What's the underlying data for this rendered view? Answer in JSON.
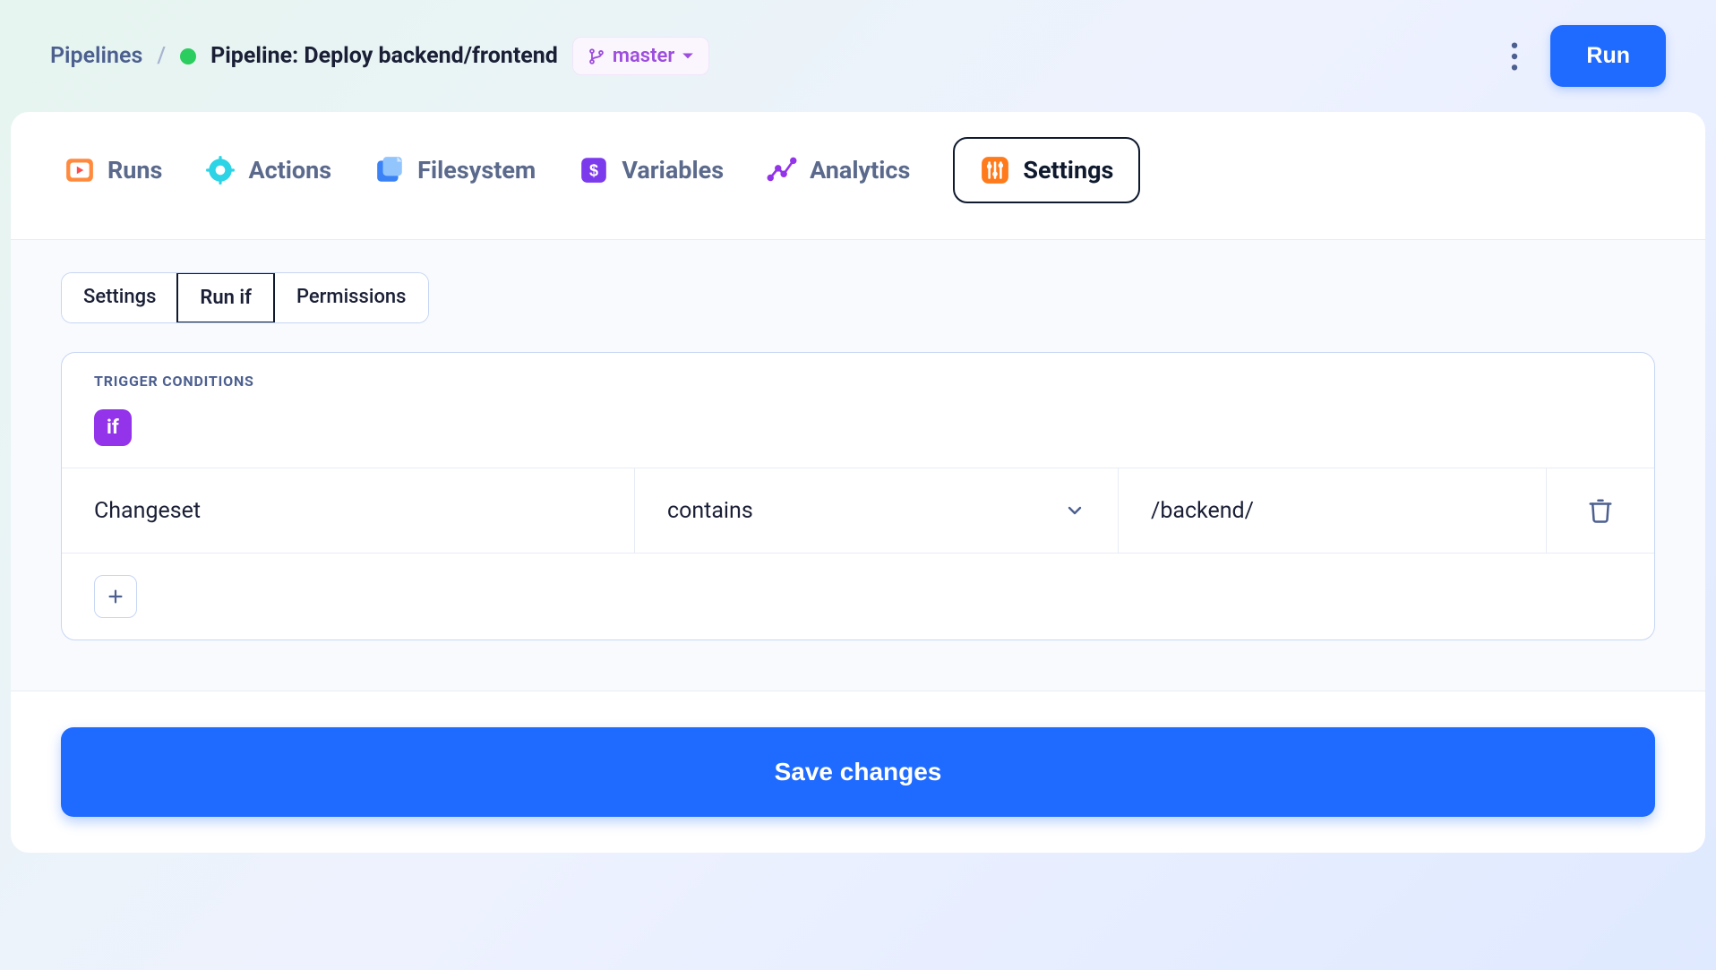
{
  "header": {
    "breadcrumb_root": "Pipelines",
    "pipeline_title": "Pipeline: Deploy backend/frontend",
    "branch": "master",
    "run_label": "Run"
  },
  "tabs": {
    "runs": "Runs",
    "actions": "Actions",
    "filesystem": "Filesystem",
    "variables": "Variables",
    "analytics": "Analytics",
    "settings": "Settings"
  },
  "sub_tabs": {
    "settings": "Settings",
    "run_if": "Run if",
    "permissions": "Permissions"
  },
  "panel": {
    "title": "Trigger Conditions",
    "if_label": "if",
    "condition": {
      "field": "Changeset",
      "operator": "contains",
      "value": "/backend/"
    }
  },
  "footer": {
    "save_label": "Save changes"
  }
}
